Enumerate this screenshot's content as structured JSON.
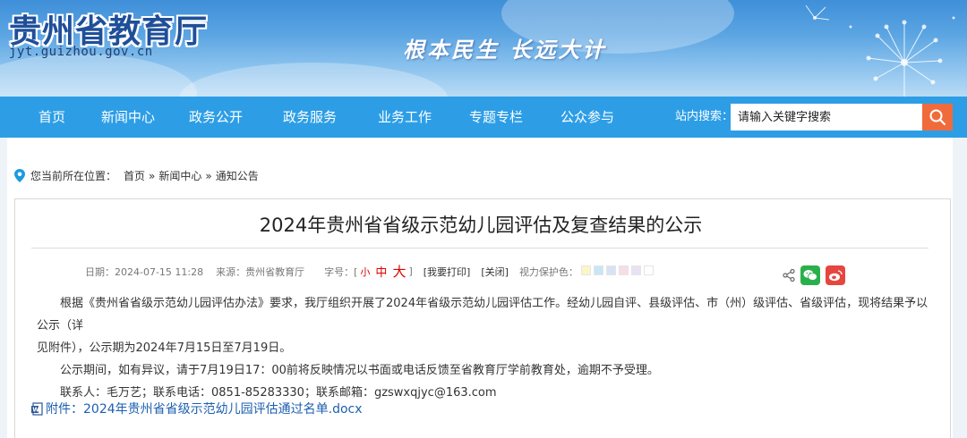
{
  "header": {
    "site_name": "贵州省教育厅",
    "site_url": "jyt.guizhou.gov.cn",
    "slogan": "根本民生 长远大计"
  },
  "nav": {
    "items": [
      "首页",
      "新闻中心",
      "政务公开",
      "政务服务",
      "业务工作",
      "专题专栏",
      "公众参与"
    ],
    "search_label": "站内搜索：",
    "search_placeholder": "请输入关键字搜索"
  },
  "breadcrumb": {
    "prefix": "您当前所在位置：",
    "items": [
      "首页",
      "新闻中心",
      "通知公告"
    ],
    "separator": "»"
  },
  "article": {
    "title": "2024年贵州省省级示范幼儿园评估及复查结果的公示",
    "date": "日期：2024-07-15 11:28",
    "source": "来源：贵州省教育厅",
    "font_size_label": "字号：[",
    "font_small": "小",
    "font_mid": "中",
    "font_big": "大",
    "font_close": "]",
    "print": "[我要打印]",
    "close": "[关闭]",
    "eye_care": "视力保护色：",
    "eye_colors": [
      "#fbf6c6",
      "#c8e6f5",
      "#d7e3f5",
      "#f7dde6",
      "#e8e3f2",
      "#ffffff"
    ],
    "paragraphs": [
      "根据《贵州省省级示范幼儿园评估办法》要求，我厅组织开展了2024年省级示范幼儿园评估工作。经幼儿园自评、县级评估、市（州）级评估、省级评估，现将结果予以公示（详",
      "见附件），公示期为2024年7月15日至7月19日。",
      "公示期间，如有异议，请于7月19日17：00前将反映情况以书面或电话反馈至省教育厅学前教育处，逾期不予受理。",
      "联系人：毛万艺；联系电话：0851-85283330；联系邮箱：gzswxqjyc@163.com"
    ],
    "attachment": "附件：2024年贵州省省级示范幼儿园评估通过名单.docx"
  },
  "colors": {
    "nav_bg": "#2d9ee6",
    "search_btn": "#f06b3c",
    "link": "#1d5fb0",
    "wechat": "#2ab04a",
    "weibo": "#e5463f"
  }
}
